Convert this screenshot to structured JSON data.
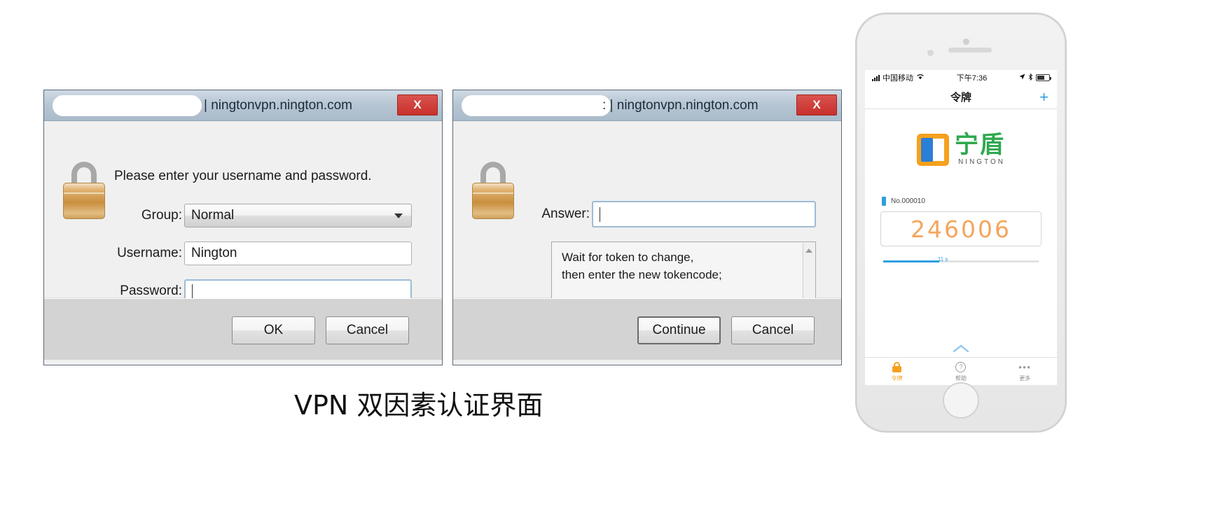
{
  "caption": "VPN 双因素认证界面",
  "login_dialog": {
    "title": "| ningtonvpn.nington.com",
    "close_label": "X",
    "lock_icon": "lock-icon",
    "prompt": "Please enter your username and password.",
    "fields": [
      {
        "label": "Group:",
        "value": "Normal",
        "type": "select"
      },
      {
        "label": "Username:",
        "value": "Nington",
        "type": "text"
      },
      {
        "label": "Password:",
        "value": "",
        "type": "password"
      }
    ],
    "buttons": [
      {
        "label": "OK"
      },
      {
        "label": "Cancel"
      }
    ]
  },
  "challenge_dialog": {
    "title": ": | ningtonvpn.nington.com",
    "close_label": "X",
    "lock_icon": "lock-icon",
    "answer_label": "Answer:",
    "answer_value": "",
    "message_line1": "Wait for token to change,",
    "message_line2": "then enter the new tokencode;",
    "buttons": [
      {
        "label": "Continue",
        "default": true
      },
      {
        "label": "Cancel",
        "default": false
      }
    ]
  },
  "phone": {
    "statusbar": {
      "carrier": "中国移动",
      "wifi_icon": "wifi-icon",
      "time": "下午7:36",
      "location_icon": "location-arrow-icon",
      "bluetooth_icon": "bluetooth-icon",
      "battery_icon": "battery-icon"
    },
    "navbar": {
      "title": "令牌",
      "add_label": "+"
    },
    "logo": {
      "cn": "宁盾",
      "en": "NINGTON"
    },
    "token": {
      "serial": "No.000010",
      "code": "246006",
      "timer_label": "11 s",
      "timer_percent": 36,
      "accent_color": "#f5a55c",
      "timer_color": "#2f9fe0"
    },
    "expand_icon": "chevron-up-icon",
    "tabs": [
      {
        "label": "令牌",
        "icon": "lock-icon",
        "active": true
      },
      {
        "label": "帮助",
        "icon": "question-circle-icon",
        "active": false
      },
      {
        "label": "更多",
        "icon": "ellipsis-icon",
        "active": false
      }
    ]
  }
}
